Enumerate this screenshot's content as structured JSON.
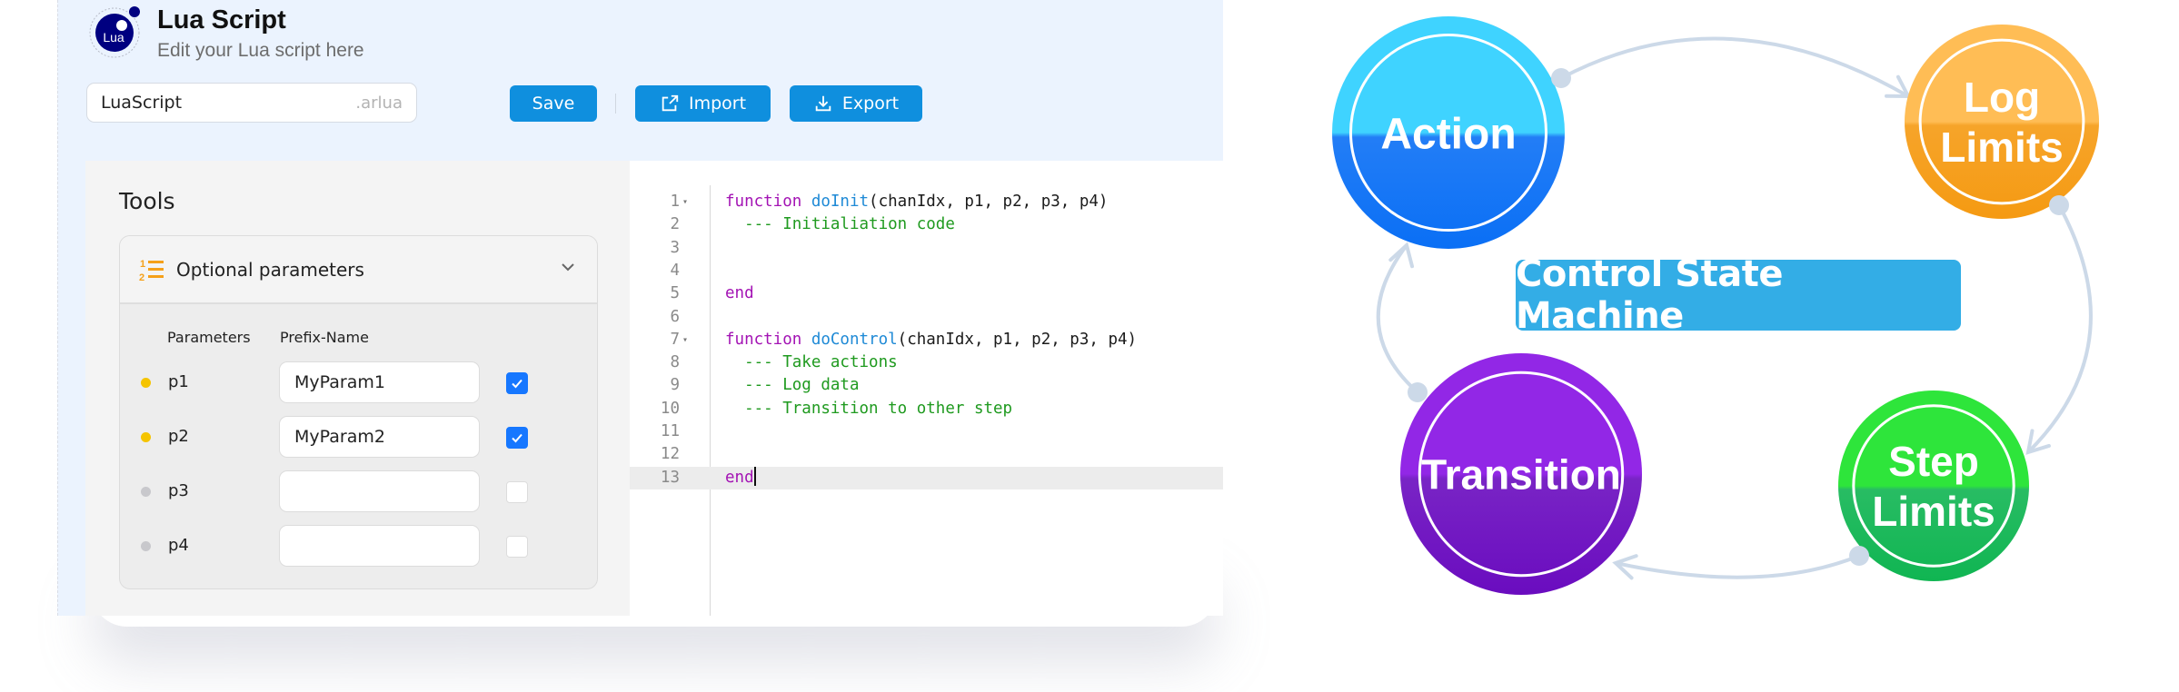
{
  "header": {
    "logo_text": "Lua",
    "title": "Lua Script",
    "subtitle": "Edit your Lua script here"
  },
  "toolbar": {
    "script_name_value": "LuaScript",
    "script_name_extension": ".arlua",
    "save_label": "Save",
    "import_label": "Import",
    "export_label": "Export"
  },
  "tools": {
    "title": "Tools",
    "accordion_label": "Optional parameters",
    "column_parameters": "Parameters",
    "column_prefix": "Prefix-Name",
    "params": [
      {
        "name": "p1",
        "prefix": "MyParam1",
        "checked": true,
        "dot_color": "#f5c400"
      },
      {
        "name": "p2",
        "prefix": "MyParam2",
        "checked": true,
        "dot_color": "#f5c400"
      },
      {
        "name": "p3",
        "prefix": "",
        "checked": false,
        "dot_color": "#c8c8cc"
      },
      {
        "name": "p4",
        "prefix": "",
        "checked": false,
        "dot_color": "#c8c8cc"
      }
    ]
  },
  "editor": {
    "active_line": 13,
    "lines": [
      {
        "n": "1",
        "fold": true,
        "tokens": [
          [
            "kw",
            "function "
          ],
          [
            "fn",
            "doInit"
          ],
          [
            "",
            "(chanIdx, p1, p2, p3, p4)"
          ]
        ]
      },
      {
        "n": "2",
        "fold": false,
        "tokens": [
          [
            "",
            "  "
          ],
          [
            "cm",
            "--- Initialiation code"
          ]
        ]
      },
      {
        "n": "3",
        "fold": false,
        "tokens": []
      },
      {
        "n": "4",
        "fold": false,
        "tokens": []
      },
      {
        "n": "5",
        "fold": false,
        "tokens": [
          [
            "kw",
            "end"
          ]
        ]
      },
      {
        "n": "6",
        "fold": false,
        "tokens": []
      },
      {
        "n": "7",
        "fold": true,
        "tokens": [
          [
            "kw",
            "function "
          ],
          [
            "fn",
            "doControl"
          ],
          [
            "",
            "(chanIdx, p1, p2, p3, p4)"
          ]
        ]
      },
      {
        "n": "8",
        "fold": false,
        "tokens": [
          [
            "",
            "  "
          ],
          [
            "cm",
            "--- Take actions"
          ]
        ]
      },
      {
        "n": "9",
        "fold": false,
        "tokens": [
          [
            "",
            "  "
          ],
          [
            "cm",
            "--- Log data"
          ]
        ]
      },
      {
        "n": "10",
        "fold": false,
        "tokens": [
          [
            "",
            "  "
          ],
          [
            "cm",
            "--- Transition to other step"
          ]
        ]
      },
      {
        "n": "11",
        "fold": false,
        "tokens": []
      },
      {
        "n": "12",
        "fold": false,
        "tokens": []
      },
      {
        "n": "13",
        "fold": false,
        "tokens": [
          [
            "kw",
            "end"
          ]
        ]
      }
    ]
  },
  "diagram": {
    "title": "Control State Machine",
    "nodes": [
      {
        "id": "action",
        "lines": [
          "Action"
        ],
        "color_top": "#3fd3ff",
        "color_bottom": "#0a6ff5"
      },
      {
        "id": "log-limits",
        "lines": [
          "Log",
          "Limits"
        ],
        "color_top": "#ffbd55",
        "color_bottom": "#f59a12"
      },
      {
        "id": "step-limits",
        "lines": [
          "Step",
          "Limits"
        ],
        "color_top": "#2ee53b",
        "color_bottom": "#10b552"
      },
      {
        "id": "transition",
        "lines": [
          "Transition"
        ],
        "color_top": "#9227e6",
        "color_bottom": "#6a0cbf"
      }
    ],
    "edges": [
      {
        "from": "action",
        "to": "log-limits"
      },
      {
        "from": "log-limits",
        "to": "step-limits"
      },
      {
        "from": "step-limits",
        "to": "transition"
      },
      {
        "from": "transition",
        "to": "action"
      }
    ],
    "edge_color": "#ccd9e8"
  }
}
